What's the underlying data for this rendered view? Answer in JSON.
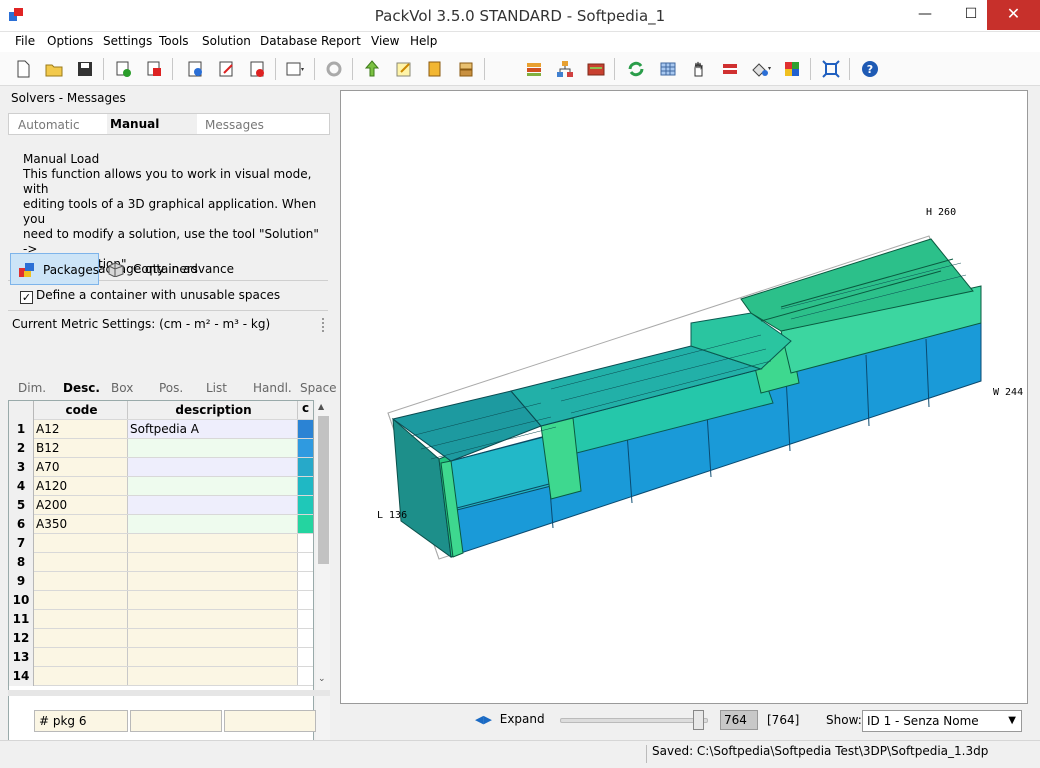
{
  "window": {
    "title": "PackVol 3.5.0 STANDARD - Softpedia_1",
    "min": "—",
    "max": "☐",
    "close": "✕"
  },
  "menu": [
    "File",
    "Options",
    "Settings",
    "Tools",
    "Solution",
    "Database",
    "Report",
    "View",
    "Help"
  ],
  "toolbar_icons": [
    "new-icon",
    "open-icon",
    "save-icon",
    "add-icon",
    "delete-icon",
    "calc-icon",
    "edit-icon",
    "print-icon",
    "view-icon",
    "gear-icon",
    "load-icon",
    "note-icon",
    "stack-icon",
    "pallet-icon",
    "layers-icon",
    "tree-icon",
    "report-icon",
    "refresh-icon",
    "grid-icon",
    "hand-icon",
    "cut-icon",
    "paint-icon",
    "color-icon",
    "fit-icon",
    "help-icon"
  ],
  "left": {
    "panel_title": "Solvers - Messages",
    "solver_tabs": [
      "Automatic",
      "Manual",
      "Messages"
    ],
    "manual_title": "Manual Load",
    "manual_lines": [
      "This function allows you to work in visual mode, with",
      "editing tools of a 3D graphical application. When you",
      "need to modify a solution, use the tool \"Solution\" ->",
      "\"Modify Solution\"."
    ],
    "check1": "Don't fix package qty in advance",
    "check2": "Define a container with unusable spaces",
    "metric": "Current Metric Settings: (cm - m² - m³ - kg)",
    "packages_btn": "Packages",
    "containers_btn": "Containers",
    "desc_tabs": [
      "Dim.",
      "Desc.",
      "Box",
      "Pos.",
      "List",
      "Handl.",
      "Space"
    ],
    "grid_headers": {
      "code": "code",
      "description": "description",
      "c": "c"
    },
    "rows": [
      {
        "n": "1",
        "code": "A12",
        "desc": "Softpedia A",
        "color": "#2b83d4",
        "descbg": "#eeeefc"
      },
      {
        "n": "2",
        "code": "B12",
        "desc": "",
        "color": "#2f9ae0",
        "descbg": "#eefbee"
      },
      {
        "n": "3",
        "code": "A70",
        "desc": "",
        "color": "#27a9c9",
        "descbg": "#eeeefc"
      },
      {
        "n": "4",
        "code": "A120",
        "desc": "",
        "color": "#1fb8c4",
        "descbg": "#eefbee"
      },
      {
        "n": "5",
        "code": "A200",
        "desc": "",
        "color": "#1fc8b8",
        "descbg": "#eeeefc"
      },
      {
        "n": "6",
        "code": "A350",
        "desc": "",
        "color": "#24d4a0",
        "descbg": "#eefbee"
      },
      {
        "n": "7",
        "code": "",
        "desc": "",
        "color": "",
        "descbg": "#fbf6e4"
      },
      {
        "n": "8",
        "code": "",
        "desc": "",
        "color": "",
        "descbg": "#fbf6e4"
      },
      {
        "n": "9",
        "code": "",
        "desc": "",
        "color": "",
        "descbg": "#fbf6e4"
      },
      {
        "n": "10",
        "code": "",
        "desc": "",
        "color": "",
        "descbg": "#fbf6e4"
      },
      {
        "n": "11",
        "code": "",
        "desc": "",
        "color": "",
        "descbg": "#fbf6e4"
      },
      {
        "n": "12",
        "code": "",
        "desc": "",
        "color": "",
        "descbg": "#fbf6e4"
      },
      {
        "n": "13",
        "code": "",
        "desc": "",
        "color": "",
        "descbg": "#fbf6e4"
      },
      {
        "n": "14",
        "code": "",
        "desc": "",
        "color": "",
        "descbg": "#fbf6e4"
      }
    ],
    "pkg_field": "# pkg 6",
    "field2": "",
    "field3": ""
  },
  "viewport": {
    "label_h": "H 260",
    "label_w": "W 244",
    "label_l": "L 136"
  },
  "bottom": {
    "expand": "Expand",
    "slider_fraction": 0.93,
    "value": "764",
    "value_total": "[764]",
    "show_label": "Show:",
    "show_value": "ID 1 - Senza Nome",
    "dropdown_arrow": "▼"
  },
  "status": {
    "saved": "Saved: C:\\Softpedia\\Softpedia Test\\3DP\\Softpedia_1.3dp"
  }
}
